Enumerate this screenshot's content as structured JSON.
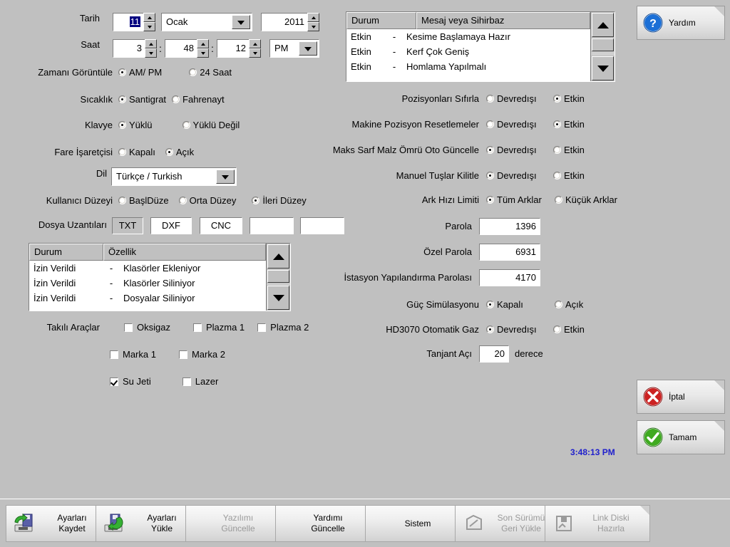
{
  "colors": {
    "background": "#c0c0c0",
    "selection": "#000080",
    "clock_text": "#2020cc",
    "disabled_text": "#9a9a9a"
  },
  "date_time": {
    "date_label": "Tarih",
    "day_value": "11",
    "month_value": "Ocak",
    "year_value": "2011",
    "time_label": "Saat",
    "hour_value": "3",
    "minute_value": "48",
    "second_value": "12",
    "ampm_value": "PM",
    "separator": ":"
  },
  "display_time": {
    "label": "Zamanı Görüntüle",
    "options": [
      "AM/ PM",
      "24 Saat"
    ],
    "selected": 0
  },
  "temperature": {
    "label": "Sıcaklık",
    "options": [
      "Santigrat",
      "Fahrenayt"
    ],
    "selected": 0
  },
  "keyboard": {
    "label": "Klavye",
    "options": [
      "Yüklü",
      "Yüklü Değil"
    ],
    "selected": 0
  },
  "mouse": {
    "label": "Fare İşaretçisi",
    "options": [
      "Kapalı",
      "Açık"
    ],
    "selected": 1
  },
  "language": {
    "label": "Dil",
    "value": "Türkçe / Turkish"
  },
  "user_level": {
    "label": "Kullanıcı Düzeyi",
    "options": [
      "BaşlDüze",
      "Orta Düzey",
      "İleri Düzey"
    ],
    "selected": 2
  },
  "file_extensions": {
    "label": "Dosya Uzantıları",
    "values": [
      "TXT",
      "DXF",
      "CNC",
      "",
      ""
    ],
    "readonly": [
      true,
      false,
      false,
      false,
      false
    ]
  },
  "messages_list": {
    "headers": [
      "Durum",
      "Mesaj veya Sihirbaz"
    ],
    "rows": [
      {
        "status": "Etkin",
        "sep": "-",
        "text": "Kesime Başlamaya Hazır"
      },
      {
        "status": "Etkin",
        "sep": "-",
        "text": "Kerf Çok Geniş"
      },
      {
        "status": "Etkin",
        "sep": "-",
        "text": "Homlama Yapılmalı"
      }
    ]
  },
  "permissions_list": {
    "headers": [
      "Durum",
      "Özellik"
    ],
    "rows": [
      {
        "status": "İzin Verildi",
        "sep": "-",
        "text": "Klasörler Ekleniyor"
      },
      {
        "status": "İzin Verildi",
        "sep": "-",
        "text": "Klasörler Siliniyor"
      },
      {
        "status": "İzin Verildi",
        "sep": "-",
        "text": "Dosyalar Siliniyor"
      }
    ]
  },
  "installed_tools": {
    "label": "Takılı Araçlar",
    "items": [
      {
        "label": "Oksigaz",
        "checked": false
      },
      {
        "label": "Plazma 1",
        "checked": false
      },
      {
        "label": "Plazma 2",
        "checked": false
      },
      {
        "label": "Marka 1",
        "checked": false
      },
      {
        "label": "Marka 2",
        "checked": false
      },
      {
        "label": "Su Jeti",
        "checked": true
      },
      {
        "label": "Lazer",
        "checked": false
      }
    ]
  },
  "reset_positions": {
    "label": "Pozisyonları Sıfırla",
    "options": [
      "Devredışı",
      "Etkin"
    ],
    "selected": 1
  },
  "machine_position_resets": {
    "label": "Makine Pozisyon Resetlemeler",
    "options": [
      "Devredışı",
      "Etkin"
    ],
    "selected": 1
  },
  "max_consumable_life": {
    "label": "Maks Sarf Malz Ömrü Oto Güncelle",
    "options": [
      "Devredışı",
      "Etkin"
    ],
    "selected": 0
  },
  "lock_manual_keys": {
    "label": "Manuel Tuşlar Kilitle",
    "options": [
      "Devredışı",
      "Etkin"
    ],
    "selected": 0
  },
  "arc_speed_limit": {
    "label": "Ark Hızı Limiti",
    "options": [
      "Tüm Arklar",
      "Küçük Arklar"
    ],
    "selected": 0
  },
  "password": {
    "label": "Parola",
    "value": "1396"
  },
  "special_password": {
    "label": "Özel Parola",
    "value": "6931"
  },
  "station_config_password": {
    "label": "İstasyon Yapılandırma Parolası",
    "value": "4170"
  },
  "power_simulation": {
    "label": "Güç Simülasyonu",
    "options": [
      "Kapalı",
      "Açık"
    ],
    "selected": 0
  },
  "hd3070_auto_gas": {
    "label": "HD3070 Otomatik Gaz",
    "options": [
      "Devredışı",
      "Etkin"
    ],
    "selected": 0
  },
  "tangent_angle": {
    "label": "Tanjant Açı",
    "value": "20",
    "unit": "derece"
  },
  "clock": {
    "value": "3:48:13 PM"
  },
  "side_buttons": [
    {
      "label": "Yardım",
      "icon": "help-icon"
    },
    {
      "label": "İptal",
      "icon": "cancel-icon"
    },
    {
      "label": "Tamam",
      "icon": "ok-icon"
    }
  ],
  "bottom_buttons": [
    {
      "label_line1": "Ayarları",
      "label_line2": "Kaydet",
      "icon": "save-settings-icon",
      "disabled": false
    },
    {
      "label_line1": "Ayarları",
      "label_line2": "Yükle",
      "icon": "load-settings-icon",
      "disabled": false
    },
    {
      "label_line1": "Yazılımı",
      "label_line2": "Güncelle",
      "icon": "",
      "disabled": true
    },
    {
      "label_line1": "Yardımı",
      "label_line2": "Güncelle",
      "icon": "",
      "disabled": false
    },
    {
      "label_line1": "Sistem",
      "label_line2": "",
      "icon": "",
      "disabled": false
    },
    {
      "label_line1": "Son Sürümü",
      "label_line2": "Geri Yükle",
      "icon": "restore-icon",
      "disabled": true
    },
    {
      "label_line1": "Link Diski",
      "label_line2": "Hazırla",
      "icon": "link-disk-icon",
      "disabled": true
    }
  ]
}
